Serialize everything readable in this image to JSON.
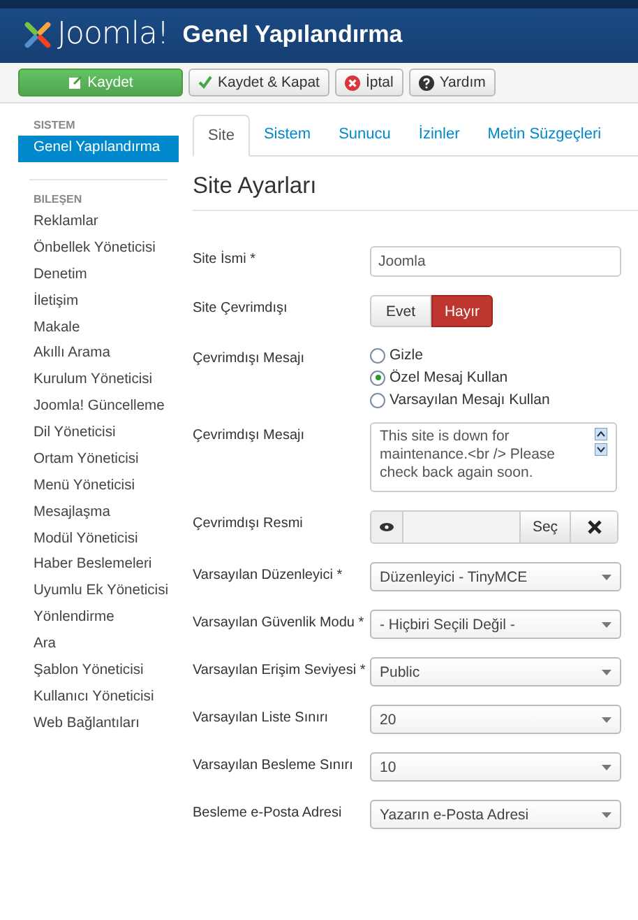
{
  "header": {
    "logo": "Joomla!",
    "title": "Genel Yapılandırma"
  },
  "toolbar": [
    {
      "label": "Kaydet",
      "kind": "save"
    },
    {
      "label": "Kaydet & Kapat",
      "kind": "save-close"
    },
    {
      "label": "İptal",
      "kind": "cancel"
    },
    {
      "label": "Yardım",
      "kind": "help"
    }
  ],
  "sidebar": {
    "sections": [
      {
        "heading": "SISTEM",
        "items": [
          {
            "label": "Genel Yapılandırma",
            "selected": true
          }
        ]
      },
      {
        "heading": "BILEŞEN",
        "items": [
          {
            "label": "Reklamlar",
            "selected": false
          },
          {
            "label": "Önbellek Yöneticisi",
            "selected": false
          },
          {
            "label": "Denetim",
            "selected": false
          },
          {
            "label": "İletişim",
            "selected": false
          },
          {
            "label": "Makale",
            "selected": false
          },
          {
            "label": "Akıllı Arama",
            "selected": false
          },
          {
            "label": "Kurulum Yöneticisi",
            "selected": false
          },
          {
            "label": "Joomla! Güncelleme",
            "selected": false
          },
          {
            "label": "Dil Yöneticisi",
            "selected": false
          },
          {
            "label": "Ortam Yöneticisi",
            "selected": false
          },
          {
            "label": "Menü Yöneticisi",
            "selected": false
          },
          {
            "label": "Mesajlaşma",
            "selected": false
          },
          {
            "label": "Modül Yöneticisi",
            "selected": false
          },
          {
            "label": "Haber Beslemeleri",
            "selected": false
          },
          {
            "label": "Uyumlu Ek Yöneticisi",
            "selected": false
          },
          {
            "label": "Yönlendirme",
            "selected": false
          },
          {
            "label": "Ara",
            "selected": false
          },
          {
            "label": "Şablon Yöneticisi",
            "selected": false
          },
          {
            "label": "Kullanıcı Yöneticisi",
            "selected": false
          },
          {
            "label": "Web Bağlantıları",
            "selected": false
          }
        ]
      }
    ]
  },
  "tabs": [
    {
      "label": "Site",
      "selected": true
    },
    {
      "label": "Sistem",
      "selected": false
    },
    {
      "label": "Sunucu",
      "selected": false
    },
    {
      "label": "İzinler",
      "selected": false
    },
    {
      "label": "Metin Süzgeçleri",
      "selected": false
    }
  ],
  "section_title": "Site Ayarları",
  "fields": [
    {
      "kind": "text",
      "label": "Site İsmi *",
      "value": "Joomla"
    },
    {
      "kind": "toggle",
      "label": "Site Çevrimdışı",
      "options": [
        {
          "label": "Evet",
          "selected": false
        },
        {
          "label": "Hayır",
          "selected": true
        }
      ]
    },
    {
      "kind": "radio",
      "label": "Çevrimdışı Mesajı",
      "options": [
        {
          "label": "Gizle",
          "selected": false
        },
        {
          "label": "Özel Mesaj Kullan",
          "selected": true
        },
        {
          "label": "Varsayılan Mesajı Kullan",
          "selected": false
        }
      ]
    },
    {
      "kind": "textarea",
      "label": "Çevrimdışı Mesajı",
      "value": "This site is down for maintenance.<br /> Please check back again soon."
    },
    {
      "kind": "media",
      "label": "Çevrimdışı Resmi",
      "button": "Seç"
    },
    {
      "kind": "select",
      "label": "Varsayılan Düzenleyici *",
      "value": "Düzenleyici - TinyMCE"
    },
    {
      "kind": "select",
      "label": "Varsayılan Güvenlik Modu *",
      "value": "- Hiçbiri Seçili Değil -"
    },
    {
      "kind": "select",
      "label": "Varsayılan Erişim Seviyesi *",
      "value": "Public"
    },
    {
      "kind": "select",
      "label": "Varsayılan Liste Sınırı",
      "value": "20"
    },
    {
      "kind": "select",
      "label": "Varsayılan Besleme Sınırı",
      "value": "10"
    },
    {
      "kind": "select",
      "label": "Besleme e-Posta Adresi",
      "value": "Yazarın e-Posta Adresi"
    }
  ]
}
